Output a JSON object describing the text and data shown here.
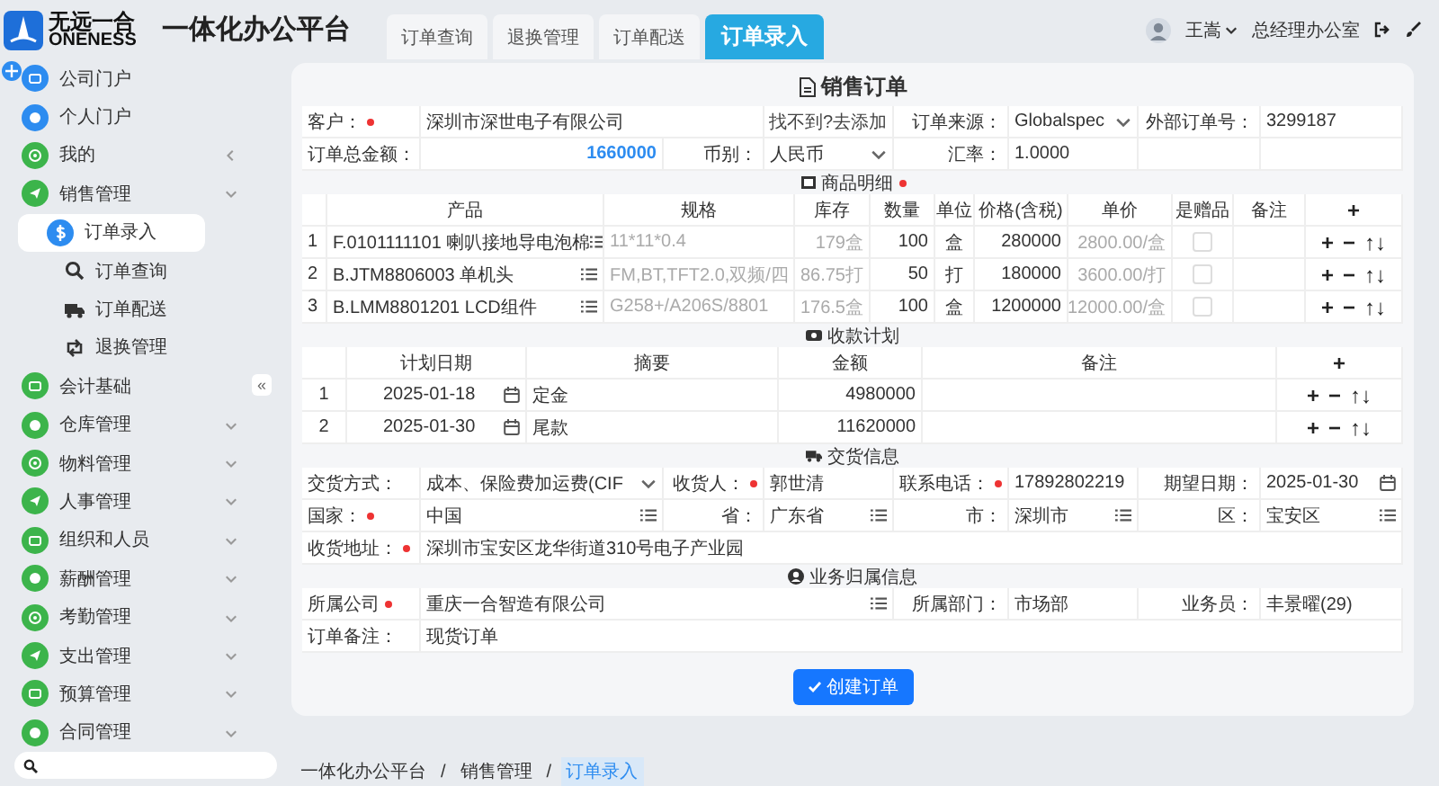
{
  "header": {
    "logo": {
      "name": "无远一合",
      "subtitle": "ONENESS"
    },
    "app_title": "一体化办公平台",
    "tabs": [
      {
        "label": "订单查询",
        "selected": false
      },
      {
        "label": "退换管理",
        "selected": false
      },
      {
        "label": "订单配送",
        "selected": false
      },
      {
        "label": "订单录入",
        "selected": true
      }
    ],
    "user": {
      "name": "王嵩",
      "department": "总经理办公室"
    }
  },
  "sidebar": {
    "collapse_button": "«",
    "items": [
      {
        "label": "公司门户",
        "color": "#2d8cf0",
        "kind": "link"
      },
      {
        "label": "个人门户",
        "color": "#2d8cf0",
        "kind": "link"
      },
      {
        "label": "我的",
        "color": "#3cb44b",
        "kind": "menu"
      },
      {
        "label": "销售管理",
        "color": "#3cb44b",
        "kind": "group",
        "children": [
          {
            "label": "订单录入",
            "selected": true
          },
          {
            "label": "订单查询",
            "selected": false
          },
          {
            "label": "订单配送",
            "selected": false
          },
          {
            "label": "退换管理",
            "selected": false
          }
        ]
      },
      {
        "label": "会计基础",
        "color": "#3cb44b",
        "kind": "link"
      },
      {
        "label": "仓库管理",
        "color": "#3cb44b",
        "kind": "group"
      },
      {
        "label": "物料管理",
        "color": "#3cb44b",
        "kind": "group"
      },
      {
        "label": "人事管理",
        "color": "#3cb44b",
        "kind": "group"
      },
      {
        "label": "组织和人员",
        "color": "#3cb44b",
        "kind": "group"
      },
      {
        "label": "薪酬管理",
        "color": "#3cb44b",
        "kind": "group"
      },
      {
        "label": "考勤管理",
        "color": "#3cb44b",
        "kind": "group"
      },
      {
        "label": "支出管理",
        "color": "#3cb44b",
        "kind": "group"
      },
      {
        "label": "预算管理",
        "color": "#3cb44b",
        "kind": "group"
      },
      {
        "label": "合同管理",
        "color": "#3cb44b",
        "kind": "group"
      }
    ]
  },
  "form": {
    "title": "销售订单",
    "order_rows": [
      [
        {
          "kind": "label",
          "text": "客户：",
          "required": true
        },
        {
          "kind": "text",
          "text": "深圳市深世电子有限公司"
        },
        {
          "kind": "link",
          "text": "找不到?去添加"
        },
        {
          "kind": "label",
          "text": "订单来源："
        },
        {
          "kind": "select",
          "text": "Globalspec"
        },
        {
          "kind": "label",
          "text": "外部订单号："
        },
        {
          "kind": "text",
          "text": "3299187"
        }
      ],
      [
        {
          "kind": "label",
          "text": "订单总金额："
        },
        {
          "kind": "amount",
          "text": "1660000"
        },
        {
          "kind": "label",
          "text": "币别："
        },
        {
          "kind": "select",
          "text": "人民币"
        },
        {
          "kind": "label",
          "text": "汇率："
        },
        {
          "kind": "text",
          "text": "1.0000"
        },
        {
          "kind": "empty"
        },
        {
          "kind": "empty"
        }
      ]
    ],
    "products": {
      "title": "商品明细",
      "required": true,
      "columns": [
        "产品",
        "规格",
        "库存",
        "数量",
        "单位",
        "价格(含税)",
        "单价",
        "是赠品",
        "备注",
        "+"
      ],
      "rows": [
        {
          "no": "1",
          "product": "F.0101111101 喇叭接地导电泡棉",
          "spec": "11*11*0.4",
          "stock": "179盒",
          "quantity": "100",
          "unit": "盒",
          "price": "280000",
          "unit_price": "2800.00/盒",
          "gift": false,
          "actions": [
            "+",
            "−",
            "↑↓"
          ]
        },
        {
          "no": "2",
          "product": "B.JTM8806003 单机头",
          "spec": "FM,BT,TFT2.0,双频/四",
          "stock": "86.75打",
          "quantity": "50",
          "unit": "打",
          "price": "180000",
          "unit_price": "3600.00/打",
          "gift": false,
          "actions": [
            "+",
            "−",
            "↑↓"
          ]
        },
        {
          "no": "3",
          "product": "B.LMM8801201 LCD组件",
          "spec": "G258+/A206S/8801",
          "stock": "176.5盒",
          "quantity": "100",
          "unit": "盒",
          "price": "1200000",
          "unit_price": "12000.00/盒",
          "gift": false,
          "actions": [
            "+",
            "−",
            "↑↓"
          ]
        }
      ]
    },
    "payment_plan": {
      "title": "收款计划",
      "columns": [
        "计划日期",
        "摘要",
        "金额",
        "备注",
        "+"
      ],
      "rows": [
        {
          "no": "1",
          "date": "2025-01-18",
          "summary": "定金",
          "amount": "4980000",
          "actions": [
            "+",
            "−",
            "↑↓"
          ]
        },
        {
          "no": "2",
          "date": "2025-01-30",
          "summary": "尾款",
          "amount": "11620000",
          "actions": [
            "+",
            "−",
            "↑↓"
          ]
        }
      ]
    },
    "delivery": {
      "title": "交货信息",
      "rows": [
        [
          {
            "kind": "label",
            "text": "交货方式："
          },
          {
            "kind": "select",
            "text": "成本、保险费加运费(CIF"
          },
          {
            "kind": "label",
            "text": "收货人：",
            "required": true
          },
          {
            "kind": "text",
            "text": "郭世清"
          },
          {
            "kind": "label",
            "text": "联系电话：",
            "required": true
          },
          {
            "kind": "text",
            "text": "17892802219"
          },
          {
            "kind": "label",
            "text": "期望日期："
          },
          {
            "kind": "date",
            "text": "2025-01-30"
          }
        ],
        [
          {
            "kind": "label",
            "text": "国家：",
            "required": true
          },
          {
            "kind": "lookup",
            "text": "中国"
          },
          {
            "kind": "label",
            "text": "省："
          },
          {
            "kind": "lookup",
            "text": "广东省"
          },
          {
            "kind": "label",
            "text": "市："
          },
          {
            "kind": "lookup",
            "text": "深圳市"
          },
          {
            "kind": "label",
            "text": "区："
          },
          {
            "kind": "lookup",
            "text": "宝安区"
          }
        ],
        [
          {
            "kind": "label",
            "text": "收货地址：",
            "required": true
          },
          {
            "kind": "text",
            "text": "深圳市宝安区龙华街道310号电子产业园"
          }
        ]
      ]
    },
    "business": {
      "title": "业务归属信息",
      "rows": [
        [
          {
            "kind": "label",
            "text": "所属公司",
            "required": true
          },
          {
            "kind": "lookup",
            "text": "重庆一合智造有限公司"
          },
          {
            "kind": "label",
            "text": "所属部门："
          },
          {
            "kind": "text",
            "text": "市场部"
          },
          {
            "kind": "label",
            "text": "业务员："
          },
          {
            "kind": "text",
            "text": "丰景曜(29)"
          }
        ],
        [
          {
            "kind": "label",
            "text": "订单备注："
          },
          {
            "kind": "text",
            "text": "现货订单"
          }
        ]
      ]
    },
    "submit_button": "创建订单"
  },
  "breadcrumb": {
    "separator": "/",
    "items": [
      {
        "label": "一体化办公平台",
        "selected": false
      },
      {
        "label": "销售管理",
        "selected": false
      },
      {
        "label": "订单录入",
        "selected": true
      }
    ]
  }
}
